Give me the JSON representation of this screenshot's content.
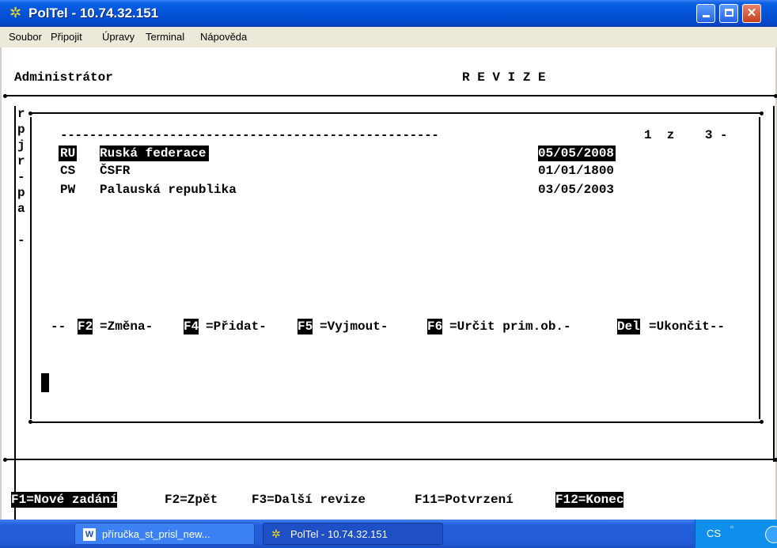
{
  "window": {
    "title": "PolTel - 10.74.32.151",
    "min": "_",
    "max": "□",
    "close": "✕"
  },
  "menu": [
    "Soubor",
    "Připojit",
    "Úpravy",
    "Terminal",
    "Nápověda"
  ],
  "header": {
    "user": "Administrátor",
    "screen": "R E V I Z E"
  },
  "left_col": [
    "r",
    "p",
    "j",
    "r",
    "-",
    "p",
    "a",
    "",
    "-"
  ],
  "pager": {
    "rule": "----------------------------------------------------",
    "text": "1  z    3 -"
  },
  "rows": [
    {
      "code": "RU",
      "name": "Ruská federace",
      "date": "05/05/2008",
      "selected": true
    },
    {
      "code": "CS",
      "name": "ČSFR",
      "date": "01/01/1800",
      "selected": false
    },
    {
      "code": "PW",
      "name": "Palauská republika",
      "date": "03/05/2003",
      "selected": false
    }
  ],
  "keys": {
    "prefix": "--",
    "f2": "F2",
    "f2_label": "=Změna-",
    "f4": "F4",
    "f4_label": "=Přidat-",
    "f5": "F5",
    "f5_label": "=Vyjmout-",
    "f6": "F6",
    "f6_label": "=Určit prim.ob.-",
    "del": "Del",
    "del_label": "=Ukončit--"
  },
  "footer": {
    "f1": "F1=Nové zadání",
    "f2": "F2=Zpět",
    "f3": "F3=Další revize",
    "f11": "F11=Potvrzení",
    "f12": "F12=Konec"
  },
  "taskbar": {
    "task1": "příručka_st_prisl_new...",
    "task2": "PolTel - 10.74.32.151",
    "lang": "CS"
  }
}
